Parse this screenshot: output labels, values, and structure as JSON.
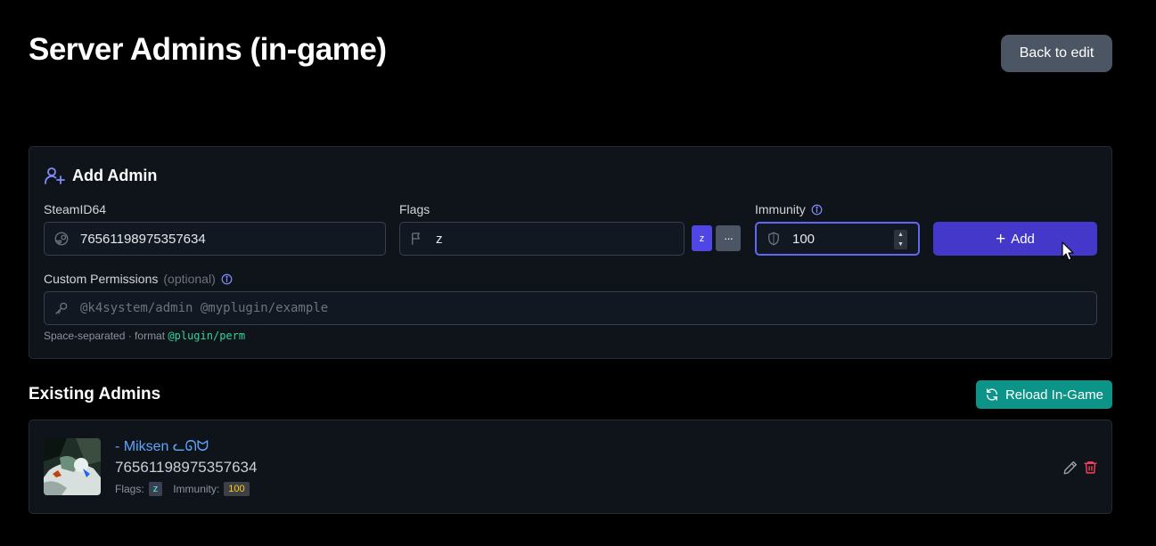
{
  "page": {
    "title": "Server Admins (in-game)",
    "back_label": "Back to edit"
  },
  "add_admin": {
    "title": "Add Admin",
    "steamid": {
      "label": "SteamID64",
      "value": "76561198975357634"
    },
    "flags": {
      "label": "Flags",
      "value": "z",
      "chip": "z",
      "more": "···"
    },
    "immunity": {
      "label": "Immunity",
      "value": "100"
    },
    "add_label": "Add",
    "custom": {
      "label": "Custom Permissions",
      "optional": "(optional)",
      "placeholder": "@k4system/admin @myplugin/example"
    },
    "hint_text": "Space-separated · format ",
    "hint_code": "@plugin/perm"
  },
  "existing": {
    "title": "Existing Admins",
    "reload_label": "Reload In-Game",
    "admins": [
      {
        "name": "- Miksen ᓚᘏᗢ",
        "steamid": "76561198975357634",
        "flags_label": "Flags:",
        "flags": "z",
        "immunity_label": "Immunity:",
        "immunity": "100"
      }
    ]
  },
  "colors": {
    "accent": "#4338ca",
    "reload": "#0d9488",
    "link": "#60a5fa",
    "delete": "#f43f5e"
  }
}
